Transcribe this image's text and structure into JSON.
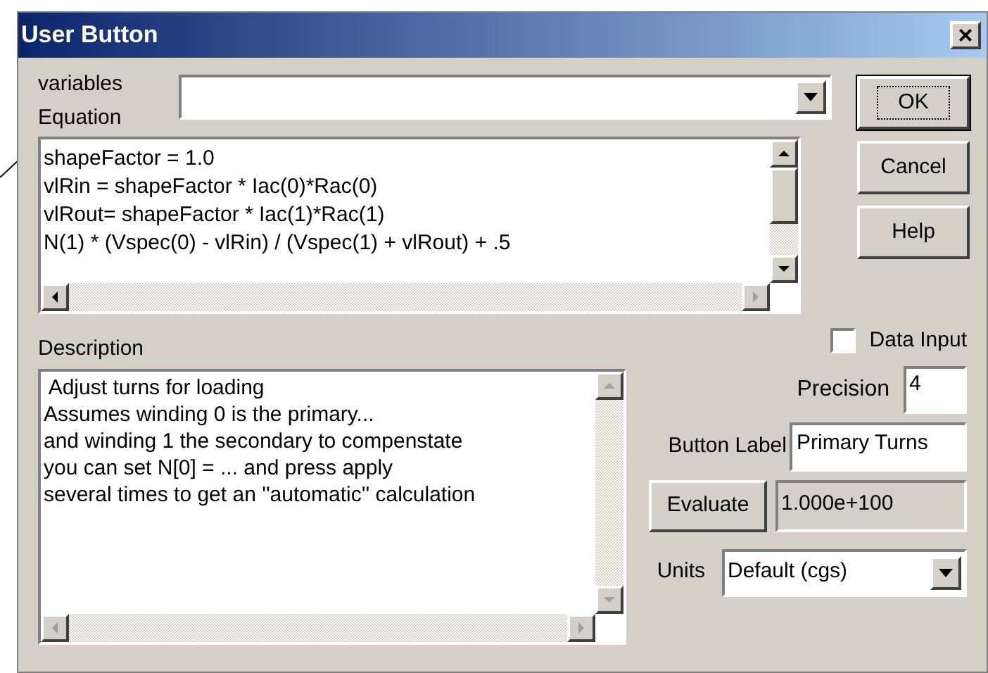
{
  "window": {
    "title": "User Button",
    "close_glyph": "×"
  },
  "variables": {
    "label": "variables"
  },
  "equation": {
    "label": "Equation",
    "lines": [
      "shapeFactor = 1.0",
      "vlRin = shapeFactor * Iac(0)*Rac(0)",
      "vlRout= shapeFactor * Iac(1)*Rac(1)",
      "N(1) * (Vspec(0) - vlRin) / (Vspec(1) + vlRout) + .5"
    ]
  },
  "buttons": [
    {
      "label": "OK",
      "default": true
    },
    {
      "label": "Cancel",
      "default": false
    },
    {
      "label": "Help",
      "default": false
    }
  ],
  "description": {
    "label": "Description",
    "lines": [
      " Adjust turns for loading",
      "Assumes winding 0 is the primary...",
      "and winding 1 the secondary to compenstate",
      "you can set N[0] = ... and press apply",
      "several times to get an ''automatic'' calculation"
    ]
  },
  "data_input": {
    "label": "Data Input",
    "checked": false
  },
  "precision": {
    "label": "Precision",
    "value": "4"
  },
  "button_label": {
    "label": "Button Label",
    "value": "Primary Turns"
  },
  "evaluate": {
    "label": "Evaluate",
    "result": "1.000e+100"
  },
  "units": {
    "label": "Units",
    "value": "Default (cgs)"
  }
}
